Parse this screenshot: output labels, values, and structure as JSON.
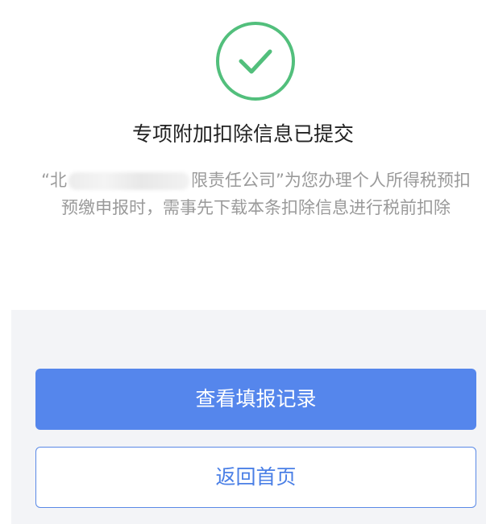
{
  "result": {
    "icon": "check-circle-icon",
    "accent_color": "#52bf7c",
    "title": "专项附加扣除信息已提交"
  },
  "message": {
    "prefix": "“北",
    "suffix": "限责任公司”为您办理个人所得税预扣预缴申报时，需事先下载本条扣除信息进行税前扣除"
  },
  "actions": {
    "view_records_label": "查看填报记录",
    "back_home_label": "返回首页",
    "primary_color": "#5586ec"
  }
}
